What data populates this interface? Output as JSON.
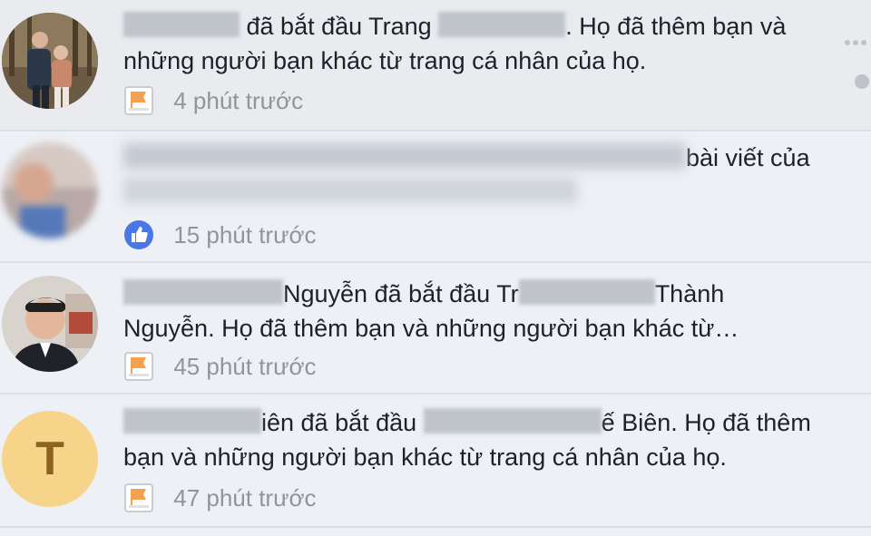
{
  "notifications": [
    {
      "avatar": "photo-couple",
      "text_a": "Bình Phú",
      "text_b": "đã bắt đầu Trang",
      "text_c": "Bình Phước",
      "text_d": ". Họ đã thêm bạn và",
      "line2": "những người bạn khác từ trang cá nhân của họ.",
      "icon": "page-flag-icon",
      "time": "4 phút trước"
    },
    {
      "avatar": "photo-blurred",
      "text_end": "bài viết của",
      "icon": "like-icon",
      "time": "15 phút trước"
    },
    {
      "avatar": "photo-man",
      "text_a": "Nguyễn đã bắt đầu Tr",
      "text_b": "Thành",
      "line2": "Nguyễn. Họ đã thêm bạn và những người bạn khác từ…",
      "icon": "page-flag-icon",
      "time": "45 phút trước"
    },
    {
      "avatar_letter": "T",
      "text_a": "iên đã bắt đầu",
      "text_b": "ế Biên. Họ đã thêm",
      "line2": "bạn và những người bạn khác từ trang cá nhân của họ.",
      "icon": "page-flag-icon",
      "time": "47 phút trước"
    }
  ],
  "colors": {
    "like_blue": "#4a77e6",
    "flag_orange": "#f5a04f",
    "letter_avatar_bg": "#f6d58a",
    "letter_avatar_fg": "#8c6420",
    "muted_text": "#90949c"
  }
}
